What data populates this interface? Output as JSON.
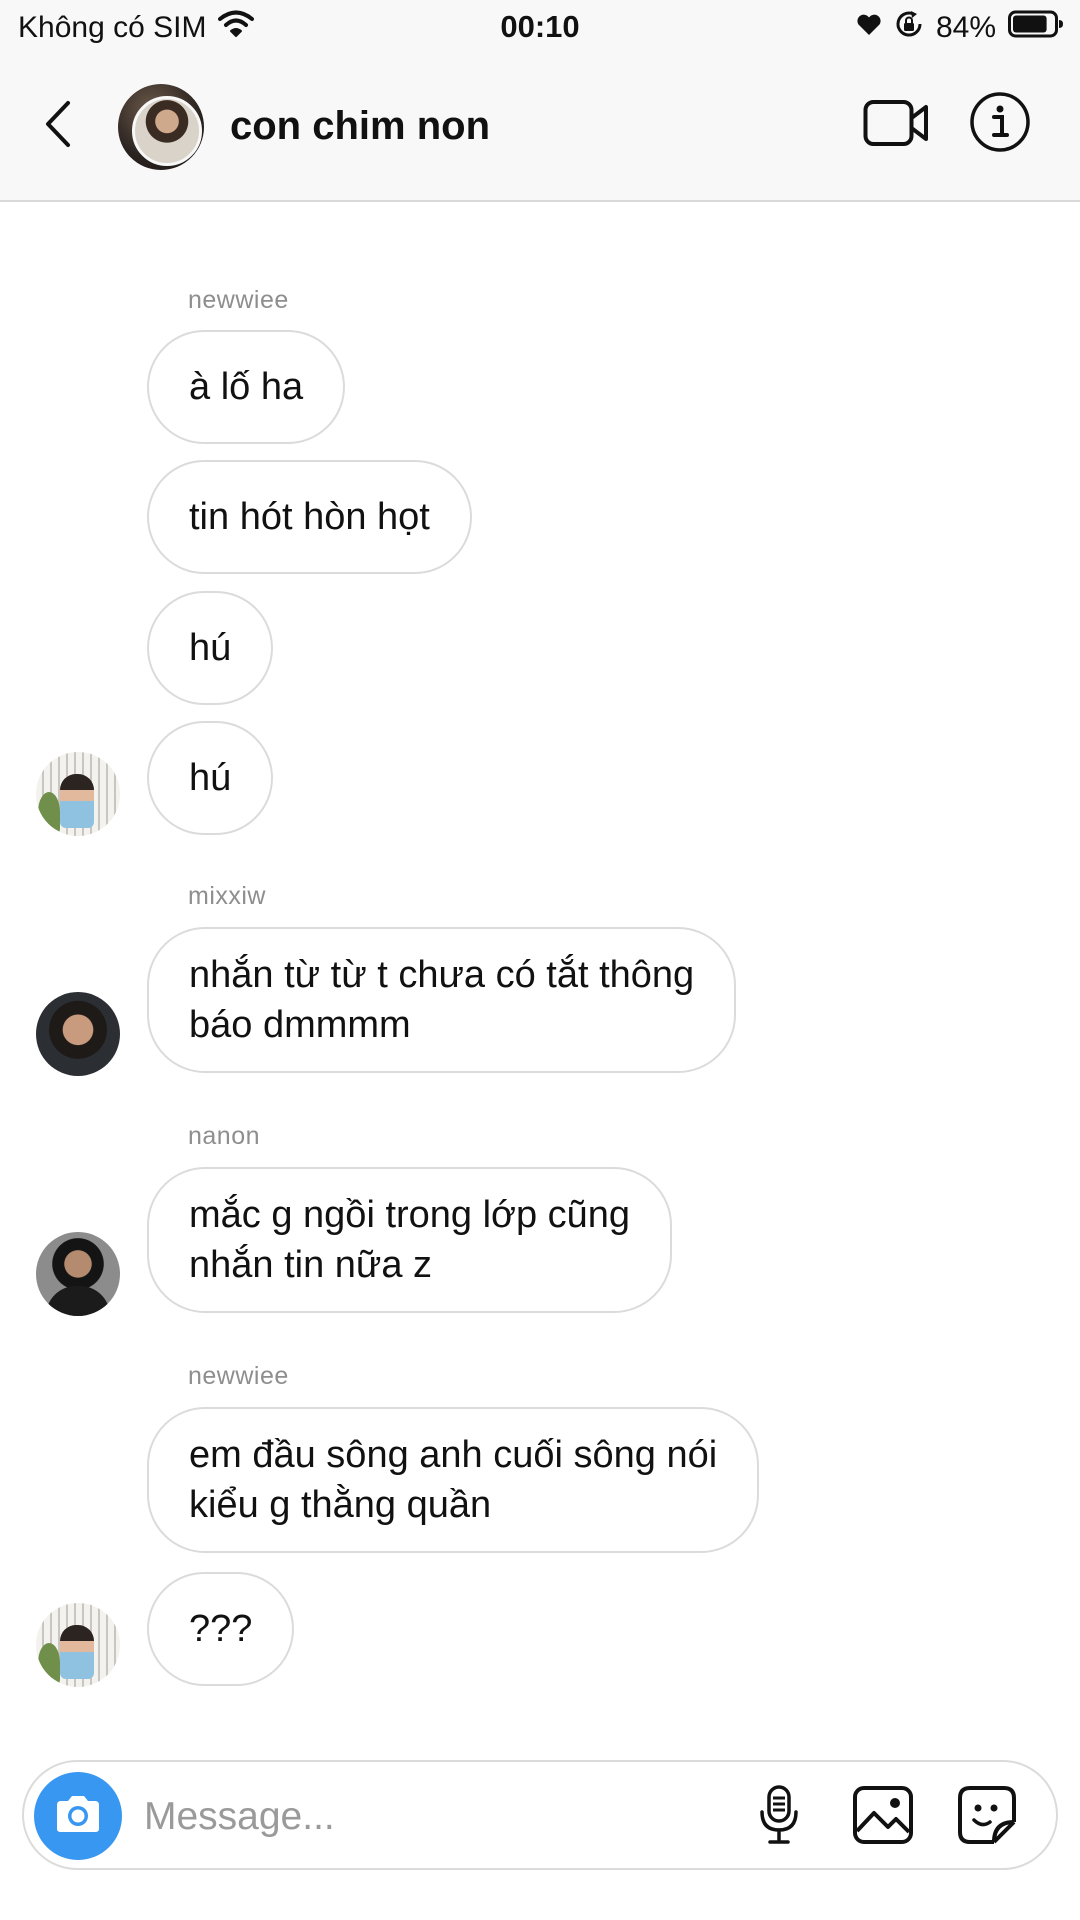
{
  "status_bar": {
    "carrier": "Không có SIM",
    "time": "00:10",
    "battery_percent": "84%",
    "battery_level": 0.84,
    "icons": [
      "wifi-icon",
      "heart-icon",
      "orientation-lock-icon",
      "battery-icon"
    ]
  },
  "header": {
    "title": "con chim non",
    "icons": [
      "back-chevron-icon",
      "video-camera-icon",
      "info-icon"
    ]
  },
  "messages": [
    {
      "sender": "newwiee",
      "text": "à lố ha"
    },
    {
      "sender": "newwiee",
      "text": "tin hót hòn họt"
    },
    {
      "sender": "newwiee",
      "text": "hú"
    },
    {
      "sender": "newwiee",
      "text": "hú"
    },
    {
      "sender": "mixxiw",
      "lines": [
        "nhắn từ từ t chưa có tắt thông",
        "báo dmmmm"
      ]
    },
    {
      "sender": "nanon",
      "lines": [
        "mắc g ngồi trong lớp cũng",
        "nhắn tin nữa z"
      ]
    },
    {
      "sender": "newwiee",
      "lines": [
        "em đầu sông anh cuối sông nói",
        "kiểu g thằng quần"
      ]
    },
    {
      "sender": "newwiee",
      "text": "???"
    }
  ],
  "composer": {
    "placeholder": "Message...",
    "icons": [
      "camera-icon",
      "microphone-icon",
      "gallery-icon",
      "sticker-icon"
    ]
  },
  "colors": {
    "accent": "#3897f0",
    "bubble_border": "#dbdbdb",
    "sender_text": "#8e8e8e",
    "bar_background": "#f8f8f8"
  }
}
